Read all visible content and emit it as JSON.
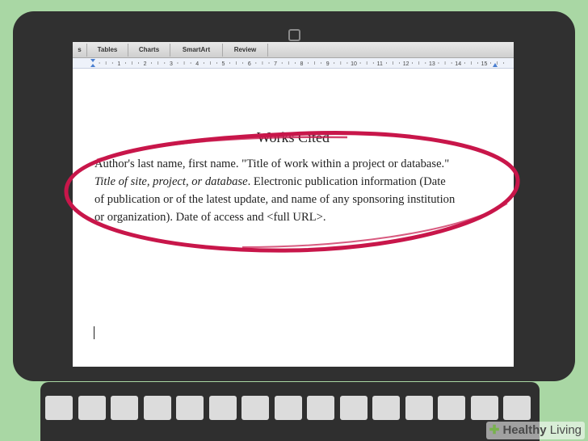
{
  "ribbon": {
    "tabs": [
      "s",
      "Tables",
      "Charts",
      "SmartArt",
      "Review"
    ]
  },
  "ruler": {
    "labels": [
      "1",
      "2",
      "3",
      "4",
      "5",
      "6",
      "7",
      "8",
      "9",
      "10",
      "11",
      "12",
      "13",
      "14",
      "15"
    ]
  },
  "document": {
    "title": "Works Cited",
    "line1": "Author's last name, first name. \"Title of work within a project or database.\"",
    "line2_italic": "Title of site, project, or database",
    "line2_rest": ". Electronic publication information (Date",
    "line3": "of publication or of the latest update, and name of any sponsoring institution",
    "line4": "or organization). Date of access and <full URL>."
  },
  "annotation": {
    "circle_color": "#c8164a"
  },
  "watermark": {
    "brand_bold": "Healthy",
    "brand_rest": " Living"
  }
}
